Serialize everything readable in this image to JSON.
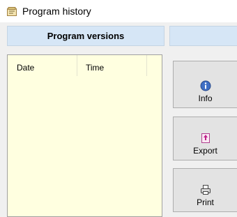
{
  "window": {
    "title": "Program history",
    "icon": "program-history-icon"
  },
  "tabs": {
    "versions_label": "Program versions"
  },
  "list": {
    "columns": [
      "Date",
      "Time"
    ]
  },
  "buttons": {
    "info": {
      "label": "Info",
      "icon": "info-icon"
    },
    "export": {
      "label": "Export",
      "icon": "export-icon"
    },
    "print": {
      "label": "Print",
      "icon": "printer-icon"
    }
  },
  "colors": {
    "tab_header_bg": "#d6e6f6",
    "list_bg": "#ffffe0",
    "button_bg": "#e3e3e3"
  }
}
